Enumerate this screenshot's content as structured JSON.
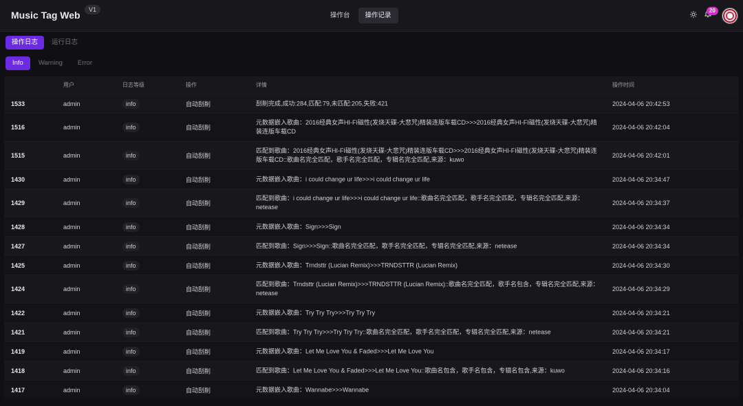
{
  "header": {
    "title": "Music Tag Web",
    "version": "V1",
    "nav": [
      "操作台",
      "操作记录"
    ],
    "notification_count": "20",
    "icons": [
      "sun-icon",
      "bell-icon"
    ]
  },
  "tabs": [
    "操作日志",
    "运行日志"
  ],
  "levels": [
    "Info",
    "Warning",
    "Error"
  ],
  "table": {
    "columns": [
      "用户",
      "日志等级",
      "操作",
      "详情",
      "操作时间"
    ],
    "rows": [
      {
        "id": "1533",
        "user": "admin",
        "level": "info",
        "op": "自动刮削",
        "detail": "刮削完成,成功:284,匹配:79,未匹配:205,失败:421",
        "time": "2024-04-06 20:42:53"
      },
      {
        "id": "1516",
        "user": "admin",
        "level": "info",
        "op": "自动刮削",
        "detail": "元数据嵌入歌曲：2016经典女声HI-FI磁性(发烧天碟-大悲咒)精装连版车载CD>>>2016经典女声HI-FI磁性(发烧天碟-大悲咒)精装连版车载CD",
        "time": "2024-04-06 20:42:04"
      },
      {
        "id": "1515",
        "user": "admin",
        "level": "info",
        "op": "自动刮削",
        "detail": "匹配到歌曲：2016经典女声HI-FI磁性(发烧天碟-大悲咒)精装连版车载CD>>>2016经典女声HI-FI磁性(发烧天碟-大悲咒)精装连版车载CD::歌曲名完全匹配，歌手名完全匹配，专辑名完全匹配,来源：kuwo",
        "time": "2024-04-06 20:42:01"
      },
      {
        "id": "1430",
        "user": "admin",
        "level": "info",
        "op": "自动刮削",
        "detail": "元数据嵌入歌曲：i could change ur life>>>i could change ur life",
        "time": "2024-04-06 20:34:47"
      },
      {
        "id": "1429",
        "user": "admin",
        "level": "info",
        "op": "自动刮削",
        "detail": "匹配到歌曲：i could change ur life>>>i could change ur life::歌曲名完全匹配，歌手名完全匹配，专辑名完全匹配,来源：netease",
        "time": "2024-04-06 20:34:37"
      },
      {
        "id": "1428",
        "user": "admin",
        "level": "info",
        "op": "自动刮削",
        "detail": "元数据嵌入歌曲：Sign>>>Sign",
        "time": "2024-04-06 20:34:34"
      },
      {
        "id": "1427",
        "user": "admin",
        "level": "info",
        "op": "自动刮削",
        "detail": "匹配到歌曲：Sign>>>Sign::歌曲名完全匹配，歌手名完全匹配，专辑名完全匹配,来源：netease",
        "time": "2024-04-06 20:34:34"
      },
      {
        "id": "1425",
        "user": "admin",
        "level": "info",
        "op": "自动刮削",
        "detail": "元数据嵌入歌曲：Trndsttr (Lucian Remix)>>>TRNDSTTR (Lucian Remix)",
        "time": "2024-04-06 20:34:30"
      },
      {
        "id": "1424",
        "user": "admin",
        "level": "info",
        "op": "自动刮削",
        "detail": "匹配到歌曲：Trndsttr (Lucian Remix)>>>TRNDSTTR (Lucian Remix)::歌曲名完全匹配，歌手名包含，专辑名完全匹配,来源：netease",
        "time": "2024-04-06 20:34:29"
      },
      {
        "id": "1422",
        "user": "admin",
        "level": "info",
        "op": "自动刮削",
        "detail": "元数据嵌入歌曲：Try Try Try>>>Try Try Try",
        "time": "2024-04-06 20:34:21"
      },
      {
        "id": "1421",
        "user": "admin",
        "level": "info",
        "op": "自动刮削",
        "detail": "匹配到歌曲：Try Try Try>>>Try Try Try::歌曲名完全匹配，歌手名完全匹配，专辑名完全匹配,来源：netease",
        "time": "2024-04-06 20:34:21"
      },
      {
        "id": "1419",
        "user": "admin",
        "level": "info",
        "op": "自动刮削",
        "detail": "元数据嵌入歌曲：Let Me Love You & Faded>>>Let Me Love You",
        "time": "2024-04-06 20:34:17"
      },
      {
        "id": "1418",
        "user": "admin",
        "level": "info",
        "op": "自动刮削",
        "detail": "匹配到歌曲：Let Me Love You & Faded>>>Let Me Love You::歌曲名包含，歌手名包含，专辑名包含,来源：kuwo",
        "time": "2024-04-06 20:34:16"
      },
      {
        "id": "1417",
        "user": "admin",
        "level": "info",
        "op": "自动刮削",
        "detail": "元数据嵌入歌曲：Wannabe>>>Wannabe",
        "time": "2024-04-06 20:34:04"
      }
    ]
  }
}
